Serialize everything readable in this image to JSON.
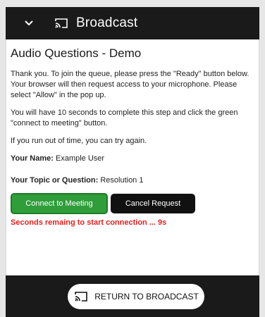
{
  "header": {
    "title": "Broadcast",
    "icons": [
      "chevron-down-icon",
      "cast-icon"
    ]
  },
  "main": {
    "heading": "Audio Questions - Demo",
    "paragraph1": "Thank you. To join the queue, please press the \"Ready\" button below. Your browser will then request access to your microphone. Please select \"Allow\" in the pop up.",
    "paragraph2": "You will have 10 seconds to complete this step and click the green \"connect to meeting\" button.",
    "paragraph3": "If you run out of time, you can try again.",
    "name_label": "Your Name:",
    "name_value": "Example User",
    "topic_label": "Your Topic or Question:",
    "topic_value": "Resolution 1",
    "connect_label": "Connect to Meeting",
    "cancel_label": "Cancel Request",
    "countdown": "Seconds remaing to start connection ... 9s"
  },
  "footer": {
    "return_label": "RETURN TO BROADCAST"
  },
  "colors": {
    "header_bg": "#1a1a1a",
    "connect_green": "#2f9e3a",
    "countdown_red": "#e02020"
  }
}
